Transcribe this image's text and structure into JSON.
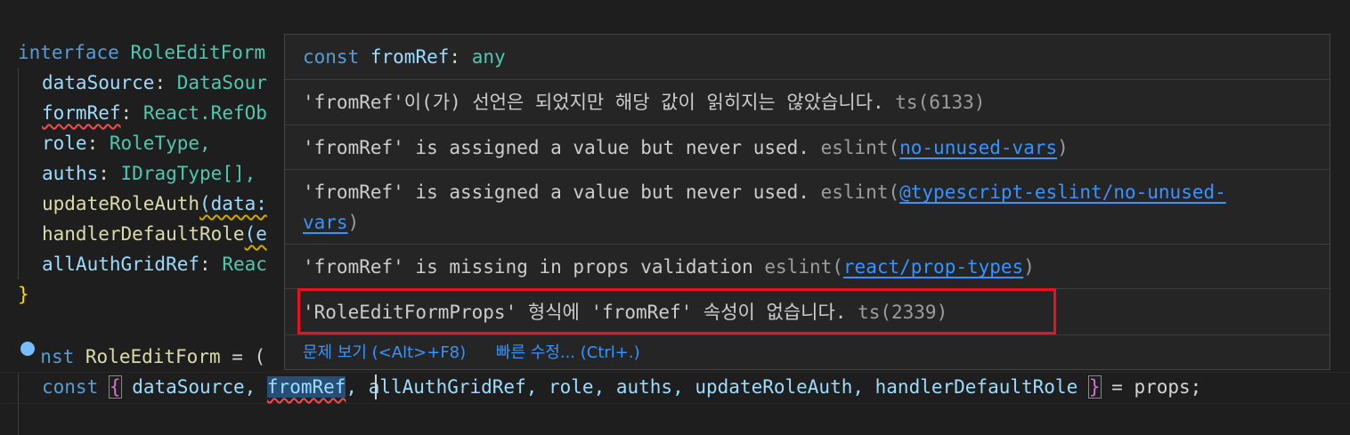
{
  "editor": {
    "interface_kw": "interface",
    "interface_name": "RoleEditForm",
    "fields": [
      {
        "name": "dataSource",
        "rest": "DataSour"
      },
      {
        "name": "formRef",
        "rest": "React.RefOb"
      },
      {
        "name": "role",
        "rest": "RoleType,"
      },
      {
        "name": "auths",
        "rest": "IDragType[],"
      },
      {
        "name": "updateRoleAuth",
        "rest": "(data:"
      },
      {
        "name": "handlerDefaultRole",
        "rest": "(e"
      },
      {
        "name": "allAuthGridRef",
        "rest": "Reac"
      }
    ],
    "close_brace": "}",
    "const_kw_tail": "nst",
    "const_name": "RoleEditForm",
    "const_rest": " = (",
    "destructure_line": {
      "kw": "const",
      "open": "{",
      "items_before": "dataSource, ",
      "highlighted": "fromRef",
      "items_after": ", allAuthGridRef, role, auths, updateRoleAuth, handlerDefaultRole ",
      "close": "}",
      "tail": " = props;"
    }
  },
  "hover": {
    "signature": {
      "kw": "const",
      "name": "fromRef",
      "colon": ":",
      "type": "any"
    },
    "messages": [
      {
        "text": "'fromRef'이(가) 선언은 되었지만 해당 값이 읽히지는 않았습니다.",
        "source": "ts(6133)"
      },
      {
        "text": "'fromRef' is assigned a value but never used.",
        "source_prefix": "eslint(",
        "rule": "no-unused-vars",
        "source_suffix": ")"
      },
      {
        "text": "'fromRef' is assigned a value but never used.",
        "source_prefix": "eslint(",
        "rule_line1": "@typescript-eslint/no-unused-",
        "rule_line2": "vars",
        "source_suffix": ")"
      },
      {
        "text": "'fromRef' is missing in props validation",
        "source_prefix": "eslint(",
        "rule": "react/prop-types",
        "source_suffix": ")"
      },
      {
        "text": "'RoleEditFormProps' 형식에 'fromRef' 속성이 없습니다.",
        "source": "ts(2339)"
      }
    ],
    "actions": [
      {
        "label": "문제 보기 (<Alt>+F8)"
      },
      {
        "label": "빠른 수정... (Ctrl+.)"
      }
    ]
  },
  "colors": {
    "background": "#1e1e1e",
    "keyword": "#569cd6",
    "type": "#4ec9b0",
    "property": "#9cdcfe",
    "function": "#dcdcaa",
    "link": "#3794ff",
    "highlight_box": "#e81123"
  },
  "icons": {
    "bulb": "lightbulb-icon"
  }
}
